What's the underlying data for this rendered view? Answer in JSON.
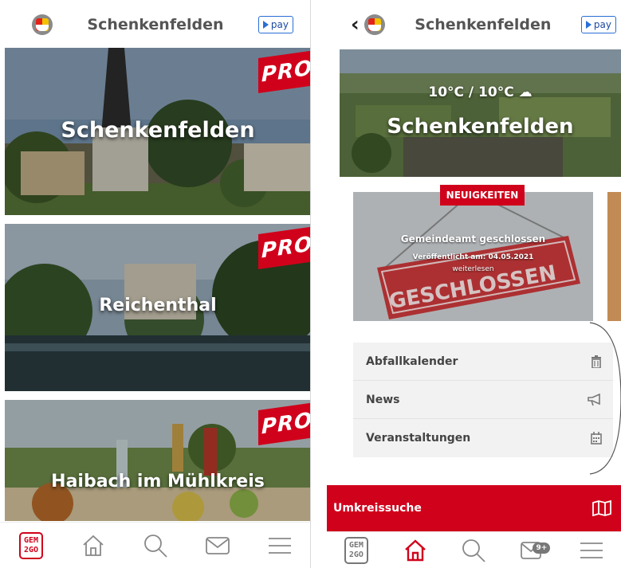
{
  "left_screen": {
    "header": {
      "title": "Schenkenfelden",
      "pay_label": "pay"
    },
    "communities": [
      {
        "name": "Schenkenfelden",
        "badge": "PRO"
      },
      {
        "name": "Reichenthal",
        "badge": "PRO"
      },
      {
        "name": "Haibach im Mühlkreis",
        "badge": "PRO"
      }
    ],
    "nav": {
      "logo_line1": "GEM",
      "logo_line2": "2GO",
      "active": "gem2go"
    }
  },
  "right_screen": {
    "header": {
      "title": "Schenkenfelden",
      "pay_label": "pay"
    },
    "hero": {
      "weather": "10°C / 10°C",
      "title": "Schenkenfelden"
    },
    "news": {
      "tag": "NEUIGKEITEN",
      "title": "Gemeindeamt geschlossen",
      "date": "Veröffentlicht am: 04.05.2021",
      "more": "weiterlesen",
      "sign_text": "GESCHLOSSEN"
    },
    "links": [
      {
        "label": "Abfallkalender",
        "icon": "trash-icon"
      },
      {
        "label": "News",
        "icon": "megaphone-icon"
      },
      {
        "label": "Veranstaltungen",
        "icon": "calendar-icon"
      }
    ],
    "radius_search": {
      "label": "Umkreissuche",
      "icon": "map-icon"
    },
    "nav": {
      "logo_line1": "GEM",
      "logo_line2": "2GO",
      "badge": "9+",
      "active": "home"
    }
  },
  "colors": {
    "accent": "#d0021b",
    "pay_blue": "#2a6fd6",
    "text_gray": "#555555"
  }
}
